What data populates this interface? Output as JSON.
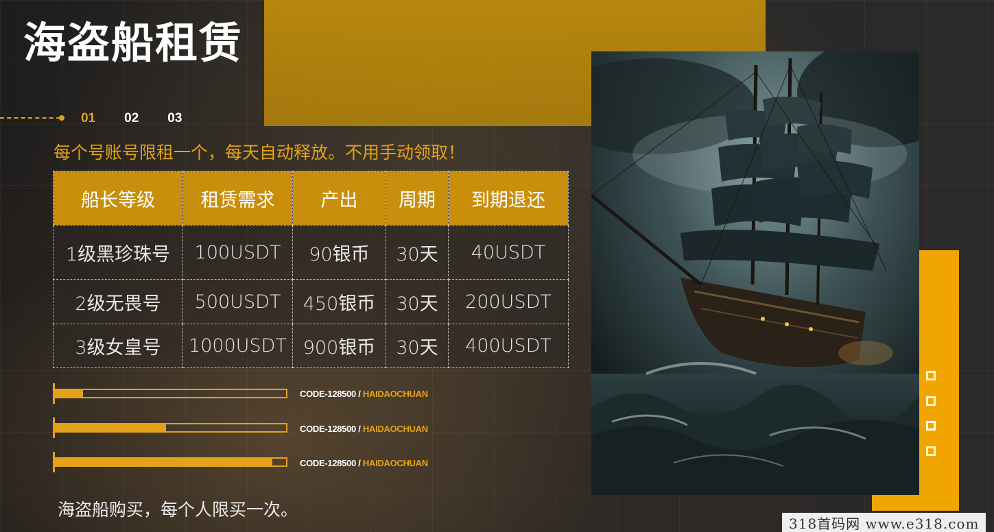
{
  "header": {
    "title": "海盗船租赁",
    "steps": [
      "01",
      "02",
      "03"
    ],
    "subtitle": "每个号账号限租一个，每天自动释放。不用手动领取！"
  },
  "table": {
    "headers": [
      "船长等级",
      "租赁需求",
      "产出",
      "周期",
      "到期退还"
    ],
    "rows": [
      [
        "1级黑珍珠号",
        "100USDT",
        "90银币",
        "30天",
        "40USDT"
      ],
      [
        "2级无畏号",
        "500USDT",
        "450银币",
        "30天",
        "200USDT"
      ],
      [
        "3级女皇号",
        "1000USDT",
        "900银币",
        "30天",
        "400USDT"
      ]
    ]
  },
  "progress": [
    {
      "level": 0.12,
      "code": "CODE-128500 /",
      "tag": "HAIDAOCHUAN"
    },
    {
      "level": 0.48,
      "code": "CODE-128500 /",
      "tag": "HAIDAOCHUAN"
    },
    {
      "level": 0.94,
      "code": "CODE-128500 /",
      "tag": "HAIDAOCHUAN"
    }
  ],
  "footer_note": "海盗船购买，每个人限买一次。",
  "watermark": "318首码网  www.e318.com",
  "colors": {
    "accent": "#e3a21a",
    "table_header": "#c98f0c",
    "side_block": "#f0a500"
  },
  "icons": [
    "square-outline-icon",
    "square-outline-icon",
    "square-outline-icon-active",
    "square-outline-icon"
  ]
}
